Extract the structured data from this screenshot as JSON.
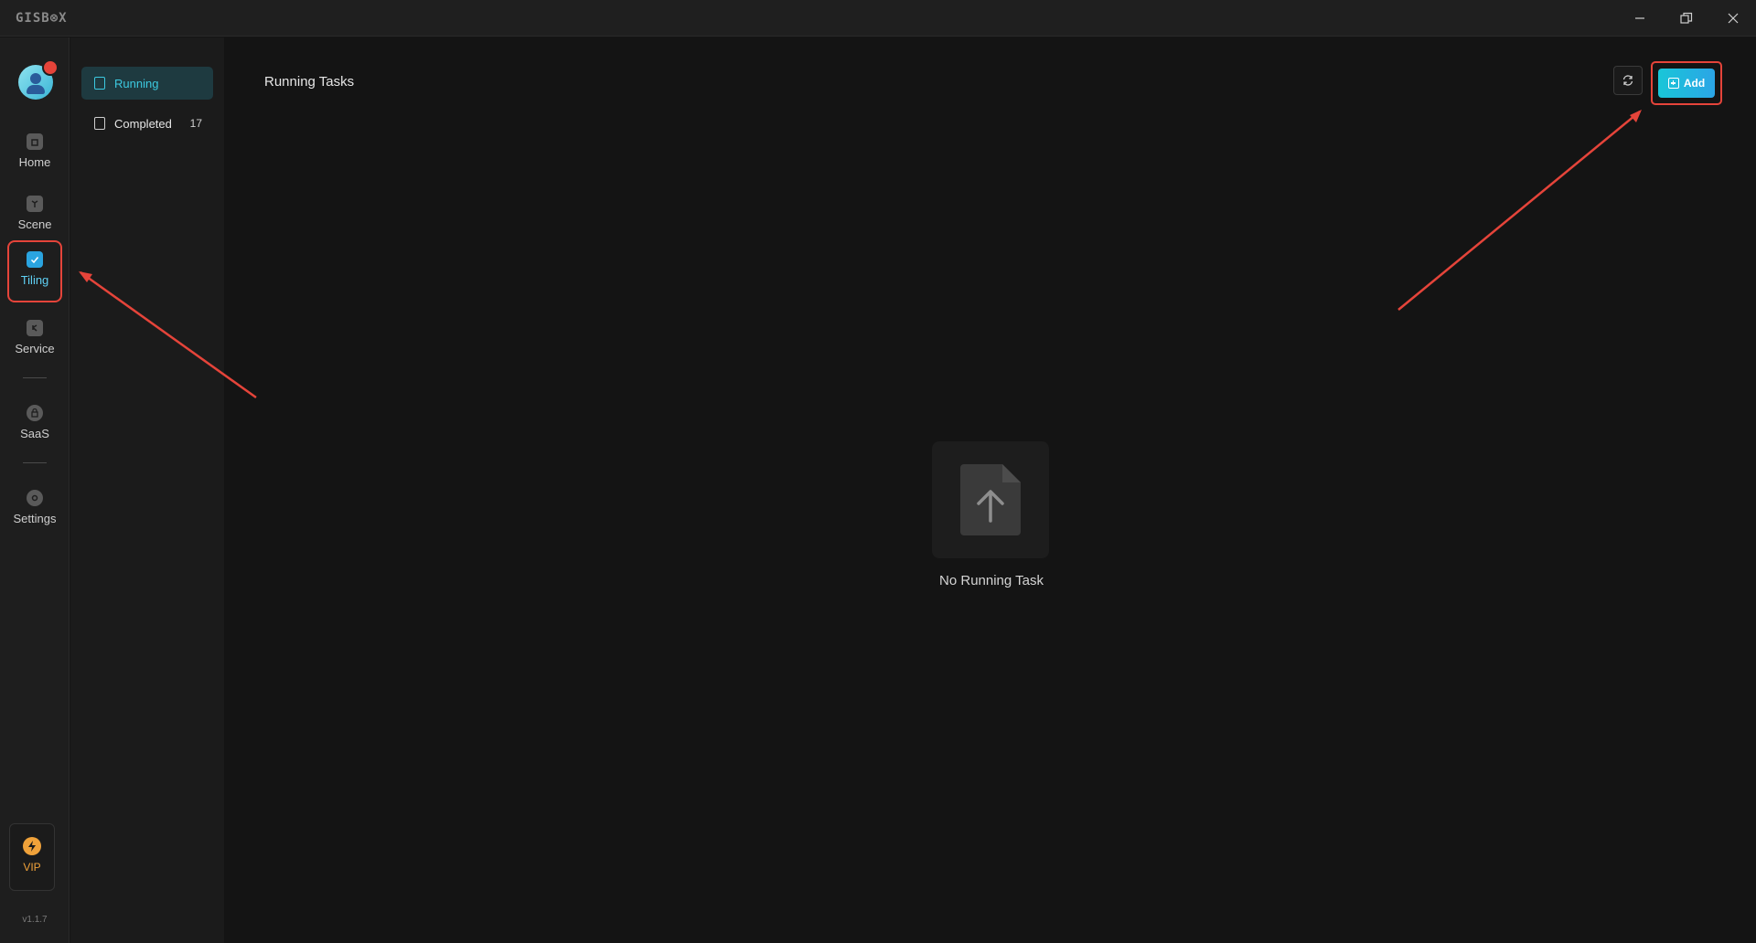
{
  "app": {
    "logo_text": "GISB⊗X"
  },
  "window_controls": {
    "minimize": "minimize-icon",
    "restore": "restore-icon",
    "close": "close-icon"
  },
  "nav": {
    "items": [
      {
        "label": "Home",
        "icon": "home-icon"
      },
      {
        "label": "Scene",
        "icon": "scene-icon"
      },
      {
        "label": "Tiling",
        "icon": "tiling-icon",
        "active": true
      },
      {
        "label": "Service",
        "icon": "service-icon"
      },
      {
        "label": "SaaS",
        "icon": "saas-icon"
      },
      {
        "label": "Settings",
        "icon": "settings-icon"
      }
    ],
    "vip_label": "VIP",
    "version": "v1.1.7"
  },
  "subnav": {
    "items": [
      {
        "label": "Running",
        "active": true
      },
      {
        "label": "Completed",
        "count": "17"
      }
    ]
  },
  "main": {
    "title": "Running Tasks",
    "add_label": "Add",
    "empty_text": "No Running Task"
  },
  "colors": {
    "accent": "#3cc9e0",
    "button_gradient_start": "#19c6d8",
    "button_gradient_end": "#2ba5e6",
    "annotation": "#e5443a",
    "vip": "#f0a23a"
  }
}
